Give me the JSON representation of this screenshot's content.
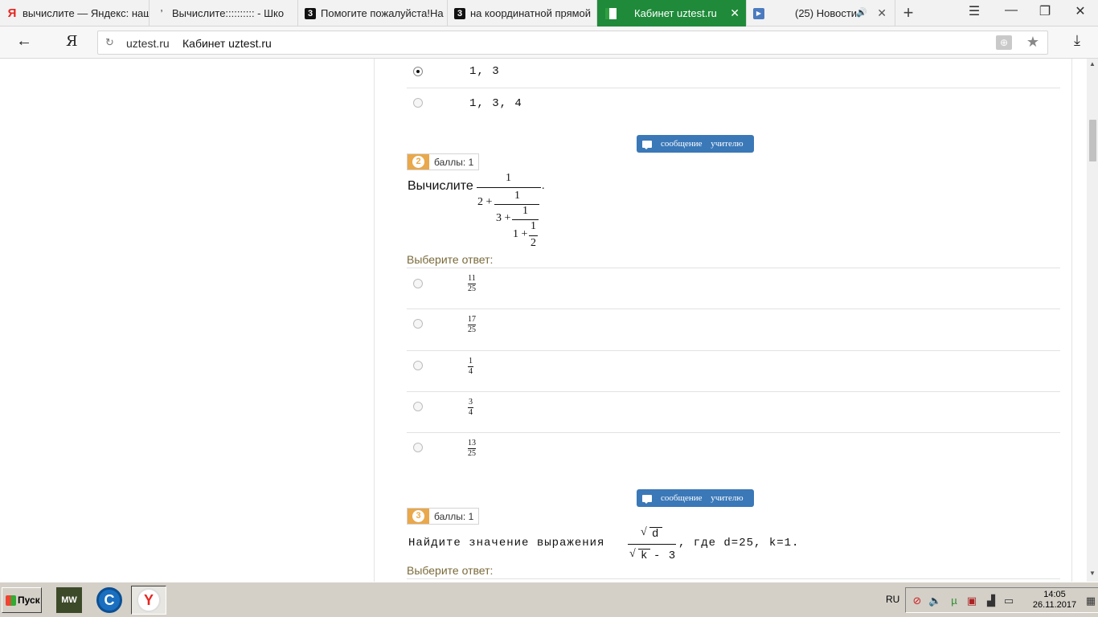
{
  "browser": {
    "tabs": [
      {
        "label": "вычислите — Яндекс: нашл",
        "icon": "yandex-icon"
      },
      {
        "label": "Вычислите:::::::::: - Шко",
        "icon": "znanija-icon"
      },
      {
        "label": "Помогите пожалуйста!На",
        "icon": "znanija-3-icon"
      },
      {
        "label": "на координатной прямой",
        "icon": "znanija-3-icon"
      },
      {
        "label": "Кабинет uztest.ru",
        "icon": "uztest-icon"
      },
      {
        "label": "(25) Новости",
        "icon": "video-icon"
      }
    ],
    "address": {
      "domain": "uztest.ru",
      "title": "Кабинет uztest.ru"
    }
  },
  "quiz": {
    "prev_options": [
      "1, 3",
      "1, 3, 4"
    ],
    "message_button": "сообщение учителю",
    "choose_label": "Выберите ответ:",
    "q2": {
      "number": "2",
      "score": "баллы: 1",
      "text": "Вычислите",
      "cf": {
        "n1": "1",
        "d1": "2 +",
        "n2": "1",
        "d2": "3 +",
        "n3": "1",
        "d3": "1 +",
        "n4": "1",
        "d4": "2",
        "dot": "."
      },
      "options": [
        {
          "num": "11",
          "den": "25"
        },
        {
          "num": "17",
          "den": "25"
        },
        {
          "num": "1",
          "den": "4"
        },
        {
          "num": "3",
          "den": "4"
        },
        {
          "num": "13",
          "den": "25"
        }
      ]
    },
    "q3": {
      "number": "3",
      "score": "баллы: 1",
      "text_before": "Найдите значение выражения",
      "num": "d",
      "den": "k",
      "den_minus": "- 3",
      "text_after": ", где d=25, k=1."
    }
  },
  "taskbar": {
    "start": "Пуск",
    "lang": "RU",
    "time": "14:05",
    "date": "26.11.2017",
    "apps": [
      {
        "label": "MW",
        "icon": "mw-icon"
      },
      {
        "label": "C",
        "icon": "ccleaner-icon"
      },
      {
        "label": "Y",
        "icon": "yandex-browser-icon"
      }
    ]
  }
}
